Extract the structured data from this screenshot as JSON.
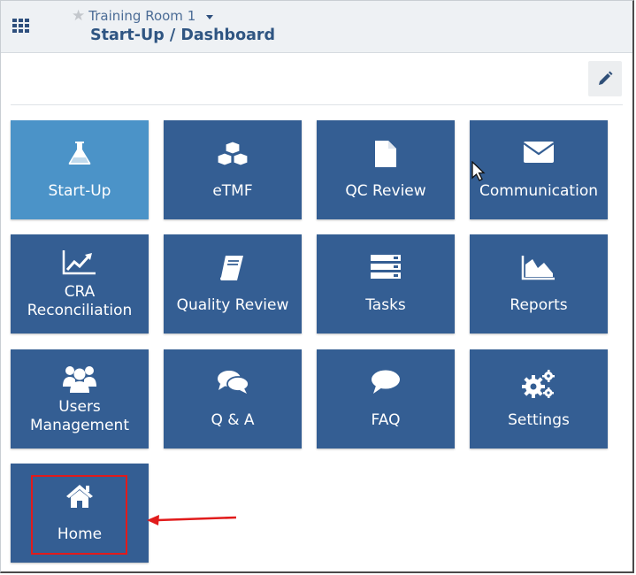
{
  "header": {
    "room_name": "Training Room 1",
    "breadcrumb": "Start-Up / Dashboard"
  },
  "colors": {
    "tile": "#345e93",
    "tile_active": "#4b93c8",
    "header_bg": "#eef1f4",
    "highlight": "#e11b1b"
  },
  "tiles": [
    {
      "label": "Start-Up",
      "icon": "flask-icon",
      "active": true
    },
    {
      "label": "eTMF",
      "icon": "cubes-icon"
    },
    {
      "label": "QC Review",
      "icon": "file-icon"
    },
    {
      "label": "Communication",
      "icon": "envelope-icon"
    },
    {
      "label": "CRA\nReconciliation",
      "icon": "line-chart-icon"
    },
    {
      "label": "Quality Review",
      "icon": "book-icon"
    },
    {
      "label": "Tasks",
      "icon": "server-icon"
    },
    {
      "label": "Reports",
      "icon": "area-chart-icon"
    },
    {
      "label": "Users\nManagement",
      "icon": "users-icon"
    },
    {
      "label": "Q & A",
      "icon": "comments-icon"
    },
    {
      "label": "FAQ",
      "icon": "comment-icon"
    },
    {
      "label": "Settings",
      "icon": "cogs-icon"
    },
    {
      "label": "Home",
      "icon": "home-icon"
    }
  ]
}
